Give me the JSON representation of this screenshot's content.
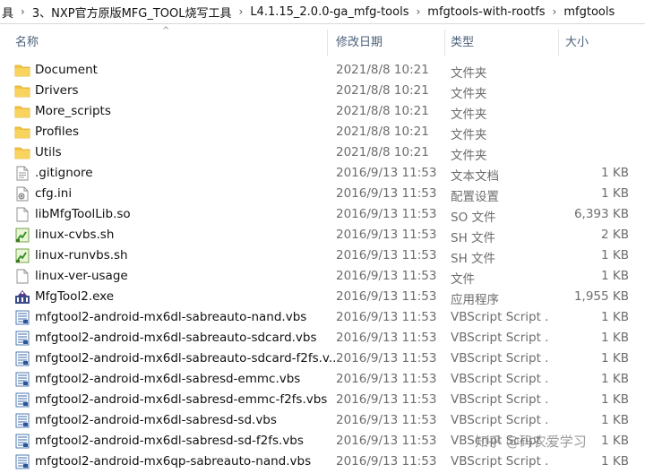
{
  "breadcrumb": {
    "items": [
      "具",
      "3、NXP官方原版MFG_TOOL烧写工具",
      "L4.1.15_2.0.0-ga_mfg-tools",
      "mfgtools-with-rootfs",
      "mfgtools"
    ]
  },
  "columns": {
    "name": "名称",
    "modified": "修改日期",
    "type": "类型",
    "size": "大小"
  },
  "files": [
    {
      "name": "Document",
      "date": "2021/8/8 10:21",
      "type": "文件夹",
      "size": "",
      "icon": "folder-icon"
    },
    {
      "name": "Drivers",
      "date": "2021/8/8 10:21",
      "type": "文件夹",
      "size": "",
      "icon": "folder-icon"
    },
    {
      "name": "More_scripts",
      "date": "2021/8/8 10:21",
      "type": "文件夹",
      "size": "",
      "icon": "folder-icon"
    },
    {
      "name": "Profiles",
      "date": "2021/8/8 10:21",
      "type": "文件夹",
      "size": "",
      "icon": "folder-icon"
    },
    {
      "name": "Utils",
      "date": "2021/8/8 10:21",
      "type": "文件夹",
      "size": "",
      "icon": "folder-icon"
    },
    {
      "name": ".gitignore",
      "date": "2016/9/13 11:53",
      "type": "文本文档",
      "size": "1 KB",
      "icon": "text-file-icon"
    },
    {
      "name": "cfg.ini",
      "date": "2016/9/13 11:53",
      "type": "配置设置",
      "size": "1 KB",
      "icon": "config-file-icon"
    },
    {
      "name": "libMfgToolLib.so",
      "date": "2016/9/13 11:53",
      "type": "SO 文件",
      "size": "6,393 KB",
      "icon": "blank-file-icon"
    },
    {
      "name": "linux-cvbs.sh",
      "date": "2016/9/13 11:53",
      "type": "SH 文件",
      "size": "2 KB",
      "icon": "shell-script-icon"
    },
    {
      "name": "linux-runvbs.sh",
      "date": "2016/9/13 11:53",
      "type": "SH 文件",
      "size": "1 KB",
      "icon": "shell-script-icon"
    },
    {
      "name": "linux-ver-usage",
      "date": "2016/9/13 11:53",
      "type": "文件",
      "size": "1 KB",
      "icon": "blank-file-icon"
    },
    {
      "name": "MfgTool2.exe",
      "date": "2016/9/13 11:53",
      "type": "应用程序",
      "size": "1,955 KB",
      "icon": "exe-icon"
    },
    {
      "name": "mfgtool2-android-mx6dl-sabreauto-nand.vbs",
      "date": "2016/9/13 11:53",
      "type": "VBScript Script ...",
      "size": "1 KB",
      "icon": "vbs-file-icon"
    },
    {
      "name": "mfgtool2-android-mx6dl-sabreauto-sdcard.vbs",
      "date": "2016/9/13 11:53",
      "type": "VBScript Script ...",
      "size": "1 KB",
      "icon": "vbs-file-icon"
    },
    {
      "name": "mfgtool2-android-mx6dl-sabreauto-sdcard-f2fs.v...",
      "date": "2016/9/13 11:53",
      "type": "VBScript Script ...",
      "size": "1 KB",
      "icon": "vbs-file-icon"
    },
    {
      "name": "mfgtool2-android-mx6dl-sabresd-emmc.vbs",
      "date": "2016/9/13 11:53",
      "type": "VBScript Script ...",
      "size": "1 KB",
      "icon": "vbs-file-icon"
    },
    {
      "name": "mfgtool2-android-mx6dl-sabresd-emmc-f2fs.vbs",
      "date": "2016/9/13 11:53",
      "type": "VBScript Script ...",
      "size": "1 KB",
      "icon": "vbs-file-icon"
    },
    {
      "name": "mfgtool2-android-mx6dl-sabresd-sd.vbs",
      "date": "2016/9/13 11:53",
      "type": "VBScript Script ...",
      "size": "1 KB",
      "icon": "vbs-file-icon"
    },
    {
      "name": "mfgtool2-android-mx6dl-sabresd-sd-f2fs.vbs",
      "date": "2016/9/13 11:53",
      "type": "VBScript Script ...",
      "size": "1 KB",
      "icon": "vbs-file-icon"
    },
    {
      "name": "mfgtool2-android-mx6qp-sabreauto-nand.vbs",
      "date": "2016/9/13 11:53",
      "type": "VBScript Script ...",
      "size": "1 KB",
      "icon": "vbs-file-icon"
    }
  ],
  "watermark": "知乎 @码农爱学习",
  "colors": {
    "folder": "#f5c542",
    "header_text": "#4c607a",
    "secondary_text": "#6d6d6d"
  }
}
